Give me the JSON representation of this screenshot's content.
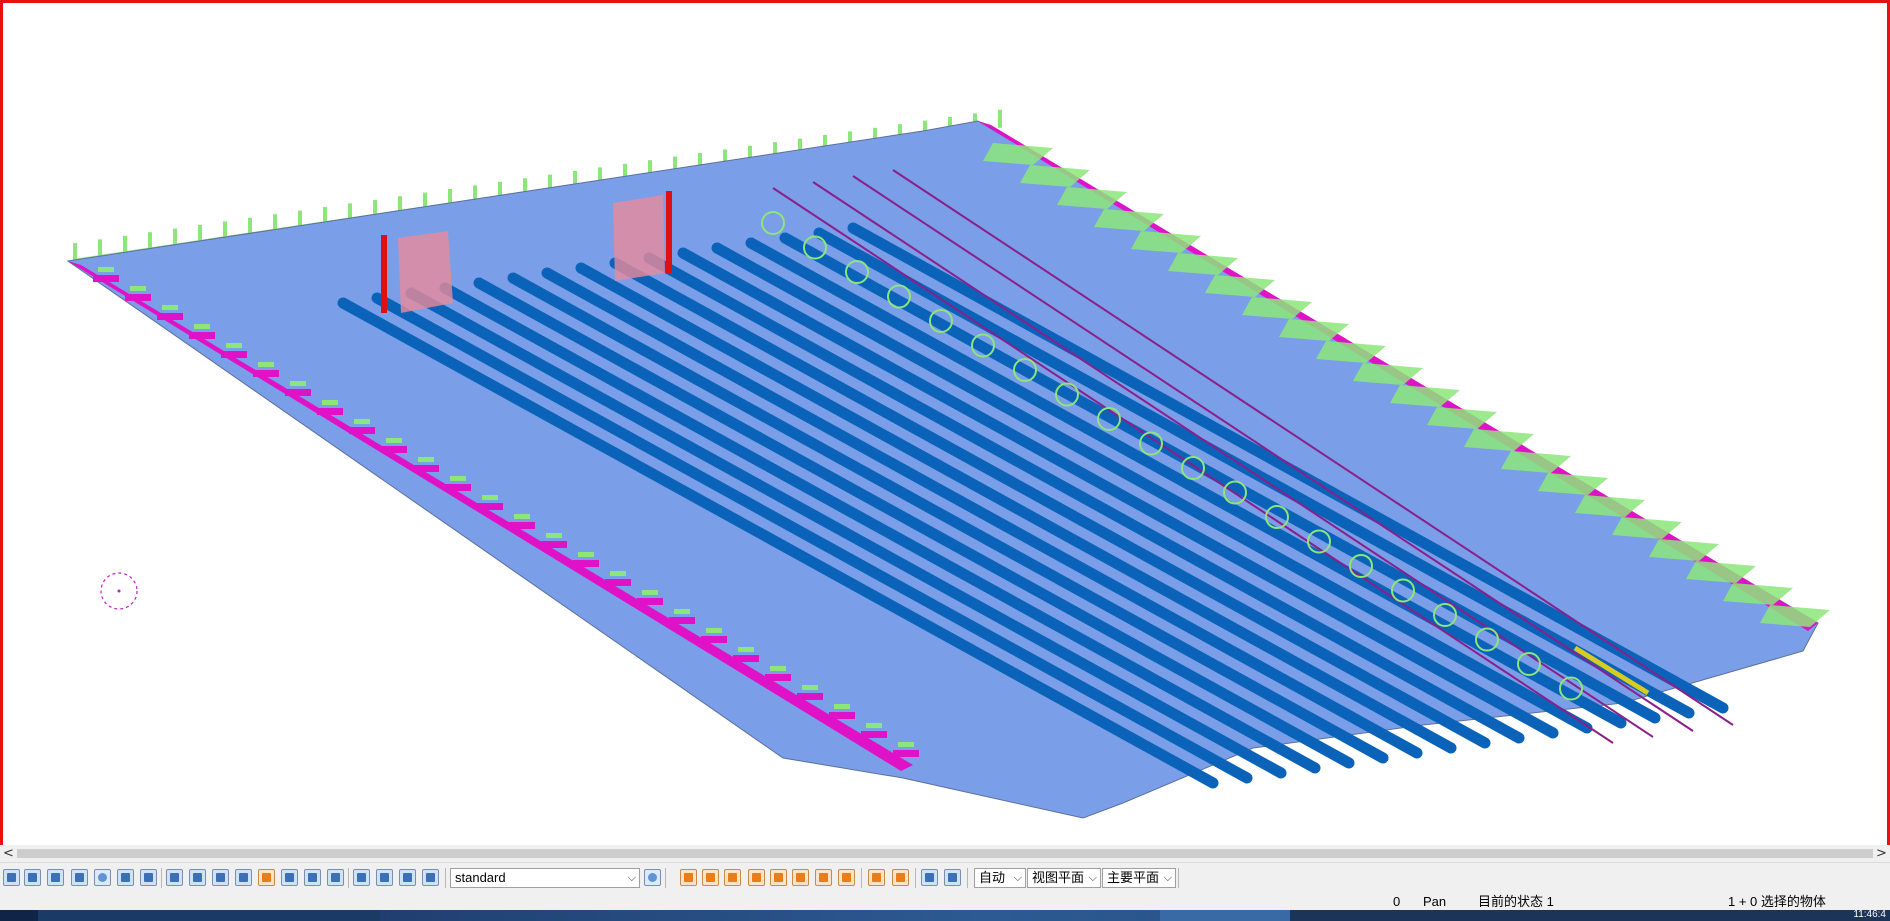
{
  "viewport": {
    "border_color": "#e81010",
    "model_colors": {
      "plate": "#7a9fe8",
      "longitudinals": "#0a63b8",
      "web_frames": "#8ce67a",
      "edge_brackets": "#e012c8",
      "tie_lines": "#8a1f8a",
      "highlight_pillars": "#e01010",
      "marker_yellow": "#d8cc20"
    },
    "cursor_icon": "crosshair-circle-icon"
  },
  "scrollbar": {
    "left_arrow": "<",
    "right_arrow": ">"
  },
  "toolbar": {
    "style_select": "standard",
    "auto_select": "自动",
    "view_plane_select": "视图平面",
    "main_plane_select": "主要平面",
    "dropdown_glyph": "⌵"
  },
  "status": {
    "count": "0",
    "mode": "Pan",
    "current_state": "目前的状态 1",
    "selection": "1 + 0 选择的物体"
  },
  "taskbar": {
    "clock": "11:46:4"
  }
}
